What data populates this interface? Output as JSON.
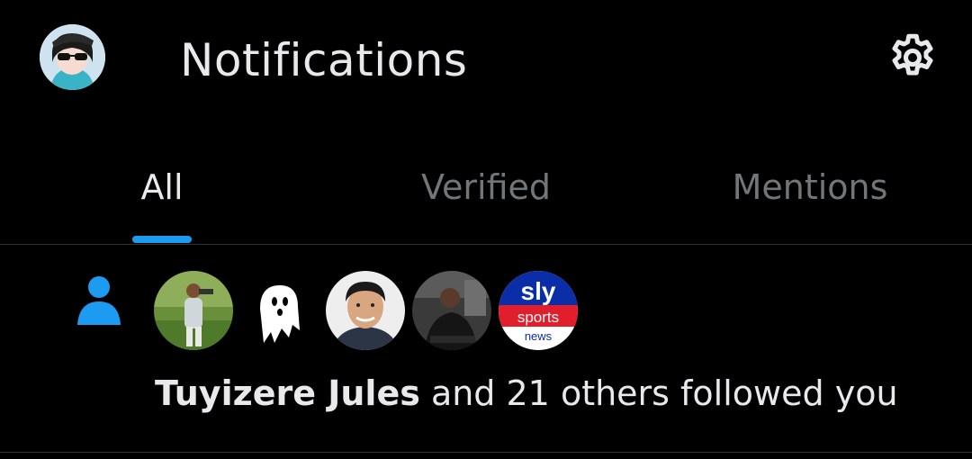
{
  "header": {
    "title": "Notifications",
    "avatar_icon": "profile-avatar",
    "settings_icon": "gear-icon"
  },
  "tabs": [
    {
      "label": "All",
      "active": true
    },
    {
      "label": "Verified",
      "active": false
    },
    {
      "label": "Mentions",
      "active": false
    }
  ],
  "notification": {
    "type_icon": "person-icon",
    "actor_name": "Tuyizere Jules",
    "message": "and 21 others followed you",
    "followers": [
      {
        "icon": "avatar-photo-outdoor"
      },
      {
        "icon": "ghost-icon"
      },
      {
        "icon": "avatar-cartoon-man"
      },
      {
        "icon": "avatar-photo-seated"
      },
      {
        "icon": "sky-sports-news-logo",
        "logo_line1": "sly",
        "logo_line2": "sports",
        "logo_line3": "news"
      }
    ]
  },
  "colors": {
    "background": "#000000",
    "accent": "#1d9bf0",
    "text_primary": "#e7e9ea",
    "text_secondary": "#71767b",
    "divider": "#2f3336"
  }
}
